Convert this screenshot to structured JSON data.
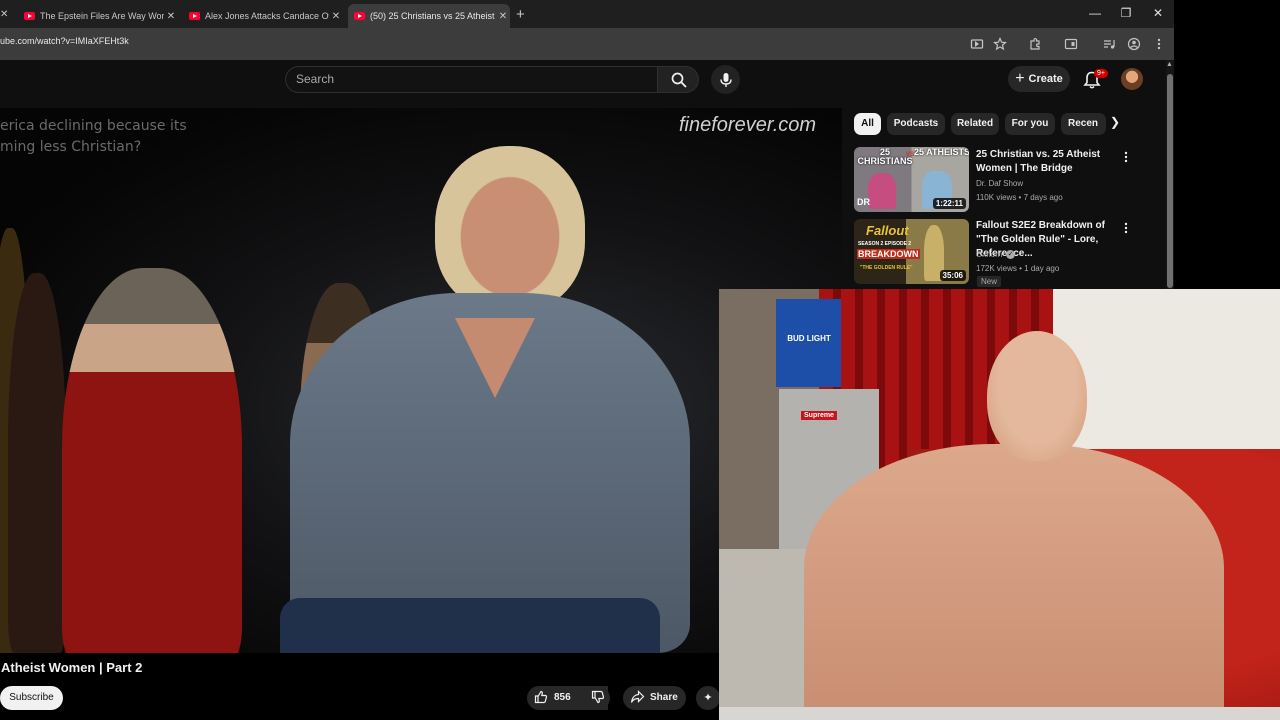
{
  "browser": {
    "tabs": [
      {
        "label": "The Epstein Files Are Way Wors",
        "active": false
      },
      {
        "label": "Alex Jones Attacks Candace Ow",
        "active": false
      },
      {
        "label": "(50) 25 Christians vs 25 Atheist",
        "active": true
      }
    ],
    "close_glyph": "✕",
    "new_tab_glyph": "+",
    "url": "ube.com/watch?v=IMIaXFEHt3k",
    "window_controls": [
      "—",
      "❐",
      "✕"
    ],
    "toolbar_icons": [
      "cast-icon",
      "star-icon",
      "extensions-icon",
      "sidepanel-icon",
      "media-icon",
      "profile-icon",
      "menu-icon"
    ]
  },
  "masthead": {
    "search_placeholder": "Search",
    "create_label": "Create",
    "notification_count": "9+"
  },
  "video": {
    "caption": "erica declining because its ming less Christian?",
    "watermark": "fineforever.com",
    "title": "Atheist Women | Part 2",
    "subscribe_label": "Subscribe",
    "like_count": "856",
    "share_label": "Share"
  },
  "sidebar": {
    "chips": [
      {
        "label": "All",
        "active": true
      },
      {
        "label": "Podcasts",
        "active": false
      },
      {
        "label": "Related",
        "active": false
      },
      {
        "label": "For you",
        "active": false
      },
      {
        "label": "Recen",
        "active": false
      }
    ],
    "videos": [
      {
        "title": "25 Christian vs. 25 Atheist Women | The Bridge",
        "channel": "Dr. Daf Show",
        "meta": "110K views • 7 days ago",
        "duration": "1:22:11",
        "thumb_text_left": "25 CHRISTIANS",
        "thumb_text_right": "25 ATHEISTS",
        "thumb_vs": "VS",
        "thumb_logo": "DR"
      },
      {
        "title": "Fallout S2E2 Breakdown of \"The Golden Rule\" - Lore, Reference...",
        "channel": "Oxhorn",
        "meta": "172K views • 1 day ago",
        "duration": "35:06",
        "badge": "New",
        "thumb_text_1": "Fallout",
        "thumb_text_2": "SEASON 2 EPISODE 2",
        "thumb_text_3": "BREAKDOWN",
        "thumb_text_4": "\"THE GOLDEN RULE\""
      }
    ]
  },
  "webcam": {
    "box_brand": "BUD LIGHT",
    "fridge_sticker": "Supreme"
  },
  "colors": {
    "yt_red": "#ff0033",
    "background": "#0f0f0f",
    "chip": "#272727"
  }
}
